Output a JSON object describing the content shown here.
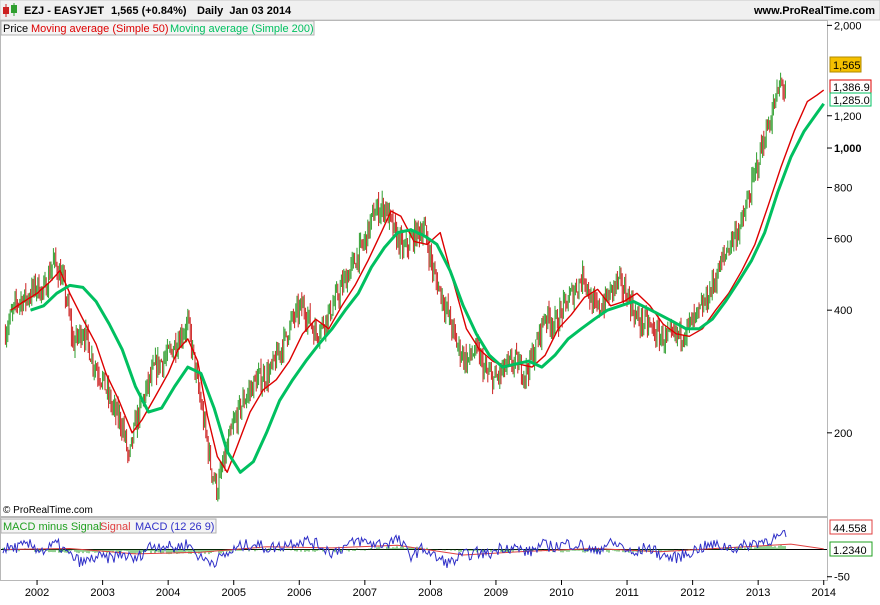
{
  "header": {
    "symbol": "EZJ - EASYJET",
    "quote": "1,565 (+0.84%)",
    "period": "Daily  Jan 03 2014",
    "site": "www.ProRealTime.com"
  },
  "colors": {
    "price_up": "#2e9e2e",
    "price_down": "#cc2020",
    "sma50": "#dd0000",
    "sma200": "#00c060",
    "macd": "#3030c8",
    "signal": "#e04040",
    "macd_minus_signal": "#20a020",
    "price_badge": "#f5c000"
  },
  "legend": {
    "price": "Price",
    "sma50": "Moving average (Simple 50)",
    "sma200": "Moving average (Simple 200)"
  },
  "macd_legend": {
    "hist": "MACD minus Signal",
    "signal": "Signal",
    "macd": "MACD (12 26 9)"
  },
  "copyright": "© ProRealTime.com",
  "badges": {
    "last_price": "1,565",
    "sma50": "1,386.9",
    "sma200": "1,285.0",
    "macd": "44.558",
    "signal": "1.2340"
  },
  "chart_data": [
    {
      "type": "line",
      "name": "price-panel",
      "y_scale": "log",
      "ylim": [
        125,
        2050
      ],
      "y_ticks": [
        {
          "value": 2000,
          "label": "2,000",
          "bold": false
        },
        {
          "value": 1200,
          "label": "1,200",
          "bold": false
        },
        {
          "value": 1000,
          "label": "1,000",
          "bold": true
        },
        {
          "value": 800,
          "label": "800",
          "bold": false
        },
        {
          "value": 600,
          "label": "600",
          "bold": false
        },
        {
          "value": 400,
          "label": "400",
          "bold": false
        },
        {
          "value": 200,
          "label": "200",
          "bold": false
        }
      ],
      "xlim": [
        2001.45,
        2014.05
      ],
      "x_ticks": [
        "2002",
        "2003",
        "2004",
        "2005",
        "2006",
        "2007",
        "2008",
        "2009",
        "2010",
        "2011",
        "2012",
        "2013",
        "2014"
      ],
      "price": {
        "x": [
          2001.5,
          2001.7,
          2001.85,
          2002.0,
          2002.1,
          2002.25,
          2002.4,
          2002.55,
          2002.7,
          2002.85,
          2003.0,
          2003.15,
          2003.3,
          2003.4,
          2003.5,
          2003.65,
          2003.8,
          2004.0,
          2004.15,
          2004.3,
          2004.45,
          2004.55,
          2004.65,
          2004.75,
          2004.85,
          2005.0,
          2005.15,
          2005.35,
          2005.55,
          2005.75,
          2005.9,
          2006.05,
          2006.25,
          2006.45,
          2006.6,
          2006.8,
          2007.0,
          2007.15,
          2007.3,
          2007.45,
          2007.6,
          2007.75,
          2007.9,
          2008.05,
          2008.25,
          2008.4,
          2008.55,
          2008.7,
          2008.85,
          2009.0,
          2009.15,
          2009.3,
          2009.45,
          2009.6,
          2009.75,
          2009.9,
          2010.05,
          2010.2,
          2010.35,
          2010.45,
          2010.55,
          2010.7,
          2010.85,
          2011.0,
          2011.15,
          2011.3,
          2011.45,
          2011.6,
          2011.75,
          2011.9,
          2012.05,
          2012.2,
          2012.35,
          2012.5,
          2012.6,
          2012.75,
          2012.9,
          2013.05,
          2013.2,
          2013.35,
          2013.5,
          2013.65,
          2013.8,
          2013.95,
          2014.0
        ],
        "values": [
          350,
          420,
          430,
          460,
          440,
          530,
          470,
          330,
          360,
          300,
          270,
          230,
          210,
          170,
          210,
          250,
          290,
          310,
          340,
          370,
          260,
          210,
          165,
          145,
          170,
          210,
          240,
          270,
          280,
          330,
          380,
          410,
          350,
          390,
          440,
          510,
          590,
          700,
          720,
          620,
          560,
          610,
          640,
          490,
          400,
          330,
          300,
          320,
          280,
          270,
          290,
          300,
          280,
          320,
          390,
          370,
          410,
          450,
          490,
          420,
          400,
          430,
          470,
          440,
          380,
          370,
          350,
          340,
          345,
          360,
          380,
          420,
          480,
          550,
          600,
          650,
          800,
          1000,
          1200,
          1450,
          1300,
          1380,
          1450,
          1530,
          1565
        ]
      },
      "series": [
        {
          "name": "Moving average (Simple 50)",
          "x": [
            2001.6,
            2001.8,
            2002.0,
            2002.2,
            2002.35,
            2002.5,
            2002.7,
            2002.9,
            2003.05,
            2003.25,
            2003.45,
            2003.6,
            2003.8,
            2004.0,
            2004.15,
            2004.3,
            2004.45,
            2004.6,
            2004.75,
            2004.9,
            2005.05,
            2005.25,
            2005.45,
            2005.65,
            2005.85,
            2006.05,
            2006.25,
            2006.45,
            2006.65,
            2006.85,
            2007.05,
            2007.25,
            2007.4,
            2007.55,
            2007.75,
            2007.95,
            2008.15,
            2008.35,
            2008.55,
            2008.75,
            2008.95,
            2009.15,
            2009.35,
            2009.55,
            2009.75,
            2009.95,
            2010.15,
            2010.35,
            2010.55,
            2010.75,
            2010.95,
            2011.15,
            2011.35,
            2011.55,
            2011.75,
            2011.95,
            2012.15,
            2012.35,
            2012.55,
            2012.75,
            2012.95,
            2013.15,
            2013.35,
            2013.55,
            2013.75,
            2013.9,
            2014.0
          ],
          "values": [
            400,
            420,
            440,
            470,
            500,
            440,
            380,
            330,
            280,
            240,
            200,
            215,
            245,
            280,
            320,
            340,
            300,
            220,
            175,
            160,
            185,
            225,
            255,
            270,
            300,
            350,
            380,
            360,
            410,
            460,
            530,
            620,
            700,
            680,
            590,
            580,
            620,
            470,
            360,
            320,
            300,
            290,
            295,
            290,
            310,
            360,
            390,
            430,
            450,
            410,
            420,
            440,
            410,
            370,
            350,
            345,
            360,
            400,
            440,
            500,
            580,
            720,
            900,
            1100,
            1300,
            1350,
            1386.9
          ]
        },
        {
          "name": "Moving average (Simple 200)",
          "x": [
            2001.9,
            2002.1,
            2002.3,
            2002.5,
            2002.7,
            2002.9,
            2003.1,
            2003.3,
            2003.5,
            2003.7,
            2003.9,
            2004.1,
            2004.3,
            2004.5,
            2004.7,
            2004.9,
            2005.1,
            2005.3,
            2005.5,
            2005.7,
            2005.9,
            2006.1,
            2006.3,
            2006.5,
            2006.7,
            2006.9,
            2007.1,
            2007.3,
            2007.5,
            2007.7,
            2007.9,
            2008.1,
            2008.3,
            2008.5,
            2008.7,
            2008.9,
            2009.1,
            2009.3,
            2009.5,
            2009.7,
            2009.9,
            2010.1,
            2010.3,
            2010.5,
            2010.7,
            2010.9,
            2011.1,
            2011.3,
            2011.5,
            2011.7,
            2011.9,
            2012.1,
            2012.3,
            2012.5,
            2012.7,
            2012.9,
            2013.1,
            2013.3,
            2013.5,
            2013.7,
            2013.9,
            2014.0
          ],
          "values": [
            400,
            410,
            440,
            460,
            455,
            420,
            370,
            320,
            260,
            225,
            230,
            260,
            290,
            280,
            230,
            180,
            160,
            170,
            200,
            240,
            270,
            300,
            330,
            360,
            400,
            440,
            510,
            570,
            620,
            630,
            610,
            580,
            500,
            410,
            350,
            310,
            290,
            295,
            300,
            290,
            310,
            340,
            360,
            380,
            400,
            410,
            420,
            405,
            390,
            375,
            360,
            360,
            380,
            420,
            470,
            530,
            620,
            780,
            950,
            1100,
            1220,
            1285
          ]
        }
      ]
    },
    {
      "type": "line",
      "name": "macd-panel",
      "ylim": [
        -56,
        58
      ],
      "y_ticks": [
        {
          "value": -50,
          "label": "-50"
        }
      ],
      "xlim": [
        2001.45,
        2014.05
      ],
      "series": [
        {
          "name": "MACD (12 26 9)",
          "x": [
            2001.5,
            2001.7,
            2001.9,
            2002.1,
            2002.3,
            2002.5,
            2002.7,
            2002.9,
            2003.1,
            2003.3,
            2003.5,
            2003.7,
            2003.9,
            2004.1,
            2004.3,
            2004.5,
            2004.7,
            2004.9,
            2005.1,
            2005.3,
            2005.5,
            2005.7,
            2005.9,
            2006.1,
            2006.3,
            2006.5,
            2006.7,
            2006.9,
            2007.1,
            2007.3,
            2007.5,
            2007.7,
            2007.9,
            2008.1,
            2008.3,
            2008.5,
            2008.7,
            2008.9,
            2009.1,
            2009.3,
            2009.5,
            2009.7,
            2009.9,
            2010.1,
            2010.3,
            2010.5,
            2010.7,
            2010.9,
            2011.1,
            2011.3,
            2011.5,
            2011.7,
            2011.9,
            2012.1,
            2012.3,
            2012.5,
            2012.7,
            2012.9,
            2013.1,
            2013.3,
            2013.5,
            2013.7,
            2013.8,
            2013.9,
            2014.0
          ],
          "values": [
            2,
            8,
            15,
            -5,
            20,
            -20,
            -45,
            -25,
            -30,
            -15,
            -35,
            10,
            15,
            5,
            20,
            -30,
            -40,
            -15,
            10,
            20,
            5,
            10,
            25,
            30,
            15,
            -10,
            10,
            30,
            20,
            20,
            35,
            -20,
            5,
            -30,
            -45,
            -20,
            -10,
            -15,
            10,
            5,
            -10,
            15,
            10,
            20,
            15,
            -10,
            20,
            15,
            -20,
            10,
            -15,
            -30,
            -15,
            5,
            15,
            10,
            5,
            20,
            30,
            40,
            50,
            -40,
            45,
            -30,
            44.558
          ]
        },
        {
          "name": "Signal",
          "x": [
            2001.5,
            2002.5,
            2003.5,
            2004.5,
            2005.5,
            2006.5,
            2007.5,
            2008.5,
            2009.5,
            2010.5,
            2011.5,
            2012.5,
            2013.5,
            2014.0
          ],
          "values": [
            0,
            2,
            -8,
            -5,
            5,
            3,
            8,
            -10,
            -3,
            2,
            -4,
            3,
            10,
            1.234
          ]
        },
        {
          "name": "MACD minus Signal",
          "x": [
            2001.5,
            2002.5,
            2003.5,
            2004.5,
            2005.5,
            2006.5,
            2007.5,
            2008.5,
            2009.5,
            2010.5,
            2011.5,
            2012.5,
            2013.5,
            2014.0
          ],
          "values": [
            2,
            -15,
            -20,
            -25,
            0,
            -13,
            20,
            -10,
            -7,
            -12,
            -11,
            7,
            30,
            43
          ]
        }
      ]
    }
  ]
}
